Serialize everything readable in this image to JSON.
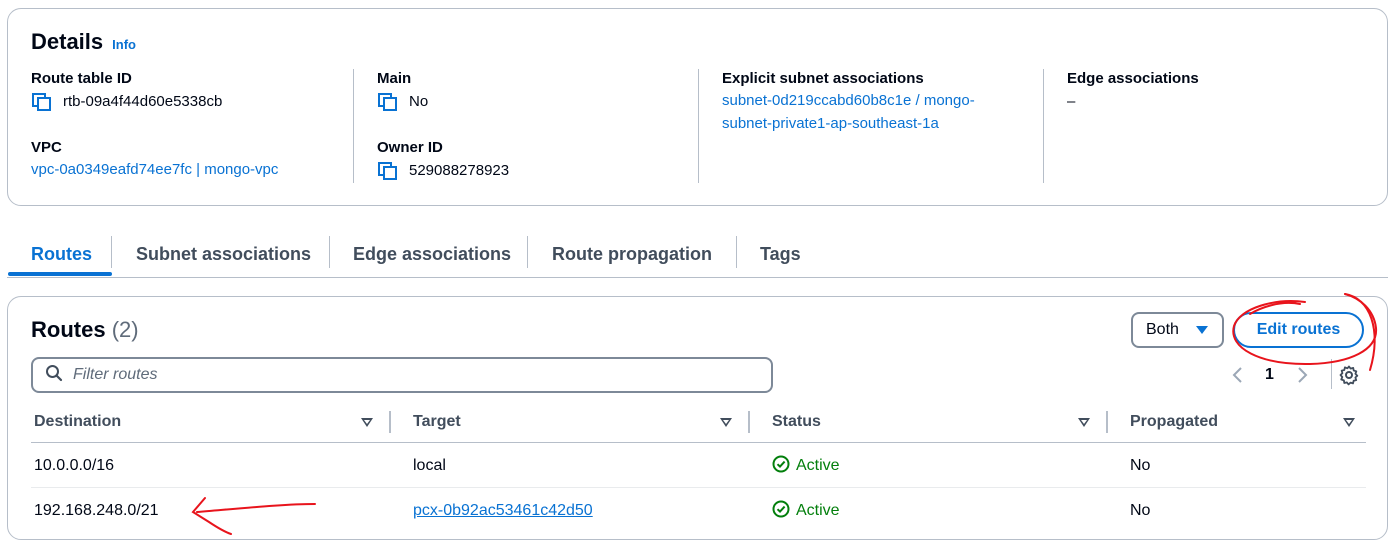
{
  "details": {
    "title": "Details",
    "info_label": "Info",
    "route_table_id_label": "Route table ID",
    "route_table_id": "rtb-09a4f44d60e5338cb",
    "vpc_label": "VPC",
    "vpc_value": "vpc-0a0349eafd74ee7fc | mongo-vpc",
    "main_label": "Main",
    "main_value": "No",
    "owner_id_label": "Owner ID",
    "owner_id": "529088278923",
    "explicit_subnet_label": "Explicit subnet associations",
    "explicit_subnet_line1": "subnet-0d219ccabd60b8c1e / mongo-",
    "explicit_subnet_line2": "subnet-private1-ap-southeast-1a",
    "edge_label": "Edge associations",
    "edge_value": "–"
  },
  "tabs": [
    {
      "label": "Routes",
      "active": true
    },
    {
      "label": "Subnet associations",
      "active": false
    },
    {
      "label": "Edge associations",
      "active": false
    },
    {
      "label": "Route propagation",
      "active": false
    },
    {
      "label": "Tags",
      "active": false
    }
  ],
  "routes": {
    "heading": "Routes",
    "count": "(2)",
    "filter_selected": "Both",
    "edit_button": "Edit routes",
    "search_placeholder": "Filter routes",
    "page_number": "1",
    "columns": [
      "Destination",
      "Target",
      "Status",
      "Propagated"
    ],
    "rows": [
      {
        "destination": "10.0.0.0/16",
        "target": "local",
        "target_is_link": false,
        "status": "Active",
        "propagated": "No"
      },
      {
        "destination": "192.168.248.0/21",
        "target": "pcx-0b92ac53461c42d50",
        "target_is_link": true,
        "status": "Active",
        "propagated": "No"
      }
    ]
  },
  "colors": {
    "link": "#0972d3",
    "success": "#037f0c",
    "annotation": "#e8141c",
    "border": "#b6bec9"
  },
  "icons": [
    "copy-icon",
    "search-icon",
    "chevron-left-icon",
    "chevron-right-icon",
    "settings-icon",
    "sort-caret-icon",
    "status-success-icon",
    "dropdown-caret-icon"
  ]
}
